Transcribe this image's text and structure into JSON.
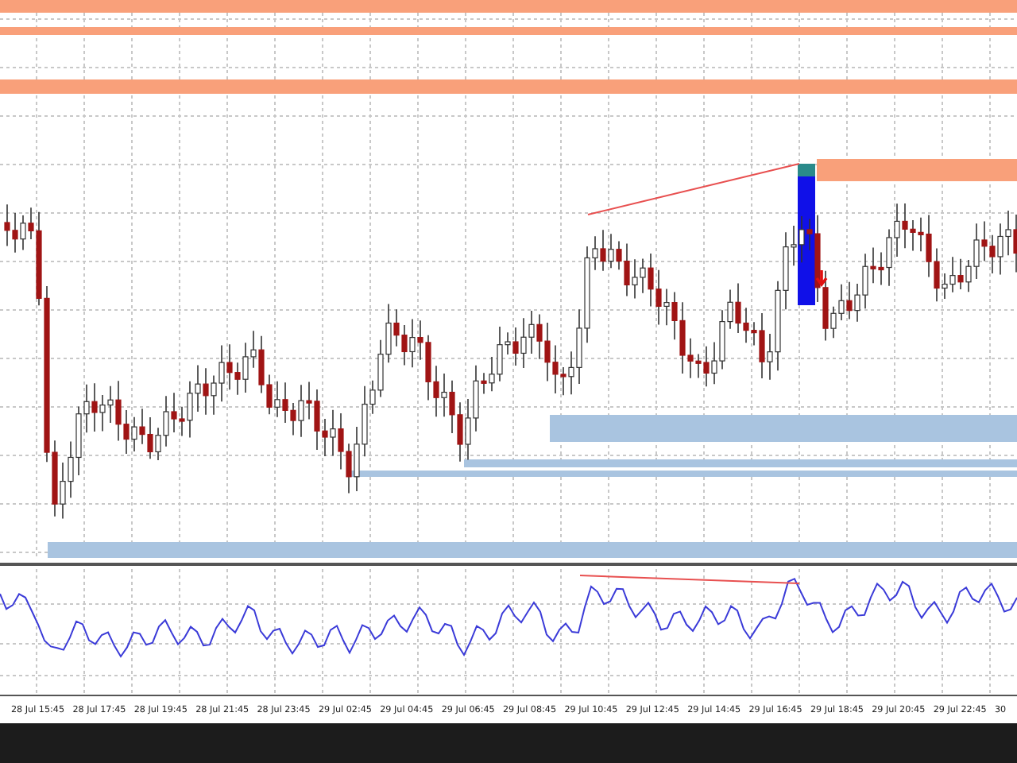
{
  "time_axis": {
    "labels": [
      "28 Jul 15:45",
      "28 Jul 17:45",
      "28 Jul 19:45",
      "28 Jul 21:45",
      "28 Jul 23:45",
      "29 Jul 02:45",
      "29 Jul 04:45",
      "29 Jul 06:45",
      "29 Jul 08:45",
      "29 Jul 10:45",
      "29 Jul 12:45",
      "29 Jul 14:45",
      "29 Jul 16:45",
      "29 Jul 18:45",
      "29 Jul 20:45",
      "29 Jul 22:45",
      "30"
    ]
  }
}
